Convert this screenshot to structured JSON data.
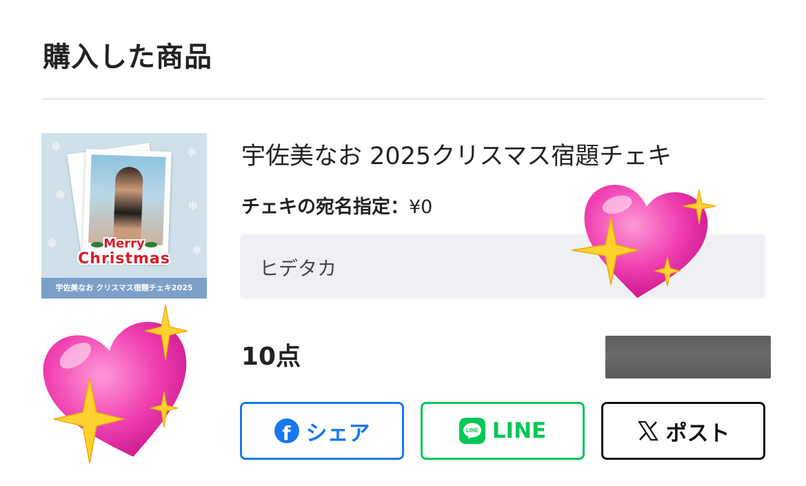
{
  "section": {
    "title": "購入した商品"
  },
  "product": {
    "title": "宇佐美なお 2025クリスマス宿題チェキ",
    "thumbnail": {
      "line1": "Merry",
      "line2": "Christmas",
      "band_text": "宇佐美なお クリスマス宿題チェキ2025"
    },
    "option_label": "チェキの宛名指定：",
    "option_price": "¥0",
    "option_value": "ヒデタカ",
    "quantity": "10点"
  },
  "share": {
    "facebook": {
      "label": "シェア",
      "icon": "facebook-icon",
      "color": "#1877f2"
    },
    "line": {
      "label": "LINE",
      "icon": "line-icon",
      "color": "#06c755",
      "icon_text": "LINE"
    },
    "x": {
      "label": "ポスト",
      "icon": "x-icon",
      "color": "#111111"
    }
  },
  "stickers": [
    "sparkling-heart-icon",
    "sparkling-heart-icon"
  ]
}
